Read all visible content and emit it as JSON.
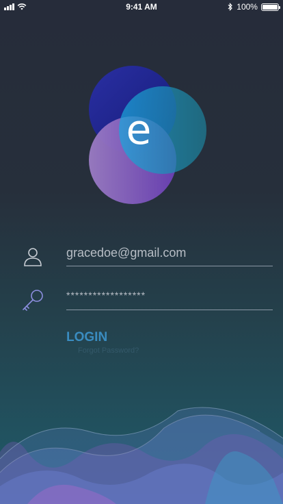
{
  "status_bar": {
    "time": "9:41 AM",
    "battery_text": "100%",
    "battery_level": 1.0,
    "icons": [
      "signal-icon",
      "wifi-icon",
      "bluetooth-icon",
      "battery-icon"
    ]
  },
  "logo": {
    "letter": "e",
    "colors": [
      "#1f2a9a",
      "#1a9ccf",
      "#8a5ac8"
    ]
  },
  "login_form": {
    "email_value": "gracedoe@gmail.com",
    "password_value": "******************",
    "email_icon": "user-icon",
    "password_icon": "key-icon",
    "login_label": "LOGIN",
    "forgot_label": "Forgot Password?"
  },
  "colors": {
    "background_top": "#262c3a",
    "background_bottom": "#1f5c6b",
    "accent": "#3a8cc0"
  }
}
